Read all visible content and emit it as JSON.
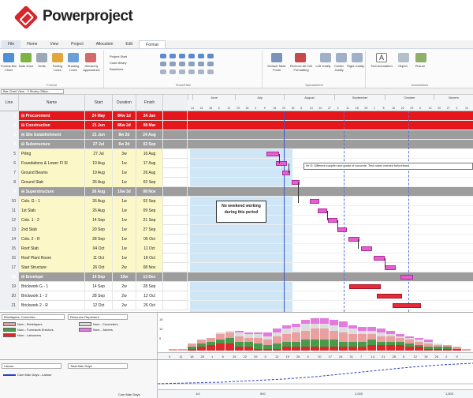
{
  "app": {
    "brand": "Powerproject"
  },
  "menu": {
    "tabs": [
      "File",
      "Home",
      "View",
      "Project",
      "Allocation",
      "Edit",
      "Format"
    ],
    "active": "Format"
  },
  "ribbon": {
    "groups": [
      {
        "name": "Format",
        "buttons": [
          "Format Bar Chart",
          "Date Zone",
          "Grids",
          "Rolling Lines",
          "Shading Lines",
          "Hierarchy Appearance"
        ]
      },
      {
        "name": "Show/Hide",
        "items": [
          "Project Start",
          "Code library",
          "Baselines"
        ]
      },
      {
        "name": "Spreadsheet",
        "buttons": [
          "Default Table Fonts",
          "Remove All Cell Formatting",
          "Left Justify",
          "Center Justify",
          "Right Justify"
        ]
      },
      {
        "name": "Annotations",
        "buttons": [
          "Text Annotation",
          "Object",
          "Picture"
        ]
      }
    ]
  },
  "view_selector": "Bar Chart View - 3 Storey Office...",
  "grid": {
    "headers": [
      "Line",
      "Name",
      "Start",
      "Duration",
      "Finish"
    ],
    "rows": [
      {
        "line": "1",
        "name": "⊟ Procurement",
        "start": "24 May",
        "duration": "84w 1d",
        "finish": "24 Jan",
        "style": "red"
      },
      {
        "line": "2",
        "name": "⊟ Construction",
        "start": "21 Jun",
        "duration": "86w 2d",
        "finish": "08 Mar",
        "style": "red"
      },
      {
        "line": "3",
        "name": "⊟ Site Establishment",
        "start": "21 Jun",
        "duration": "8w 2d",
        "finish": "24 Aug",
        "style": "grey"
      },
      {
        "line": "4",
        "name": "⊟ Substructure",
        "start": "27 Jul",
        "duration": "6w 2d",
        "finish": "02 Sep",
        "style": "grey"
      },
      {
        "line": "5",
        "name": "Piling",
        "start": "27 Jul",
        "duration": "3w",
        "finish": "16 Aug",
        "style": "yellow"
      },
      {
        "line": "6",
        "name": "Foundations & Lower Fl Sl",
        "start": "10 Aug",
        "duration": "1w",
        "finish": "17 Aug",
        "style": "yellow"
      },
      {
        "line": "7",
        "name": "Ground Beams",
        "start": "19 Aug",
        "duration": "1w",
        "finish": "26 Aug",
        "style": "yellow"
      },
      {
        "line": "8",
        "name": "Ground Slab",
        "start": "26 Aug",
        "duration": "1w",
        "finish": "02 Sep",
        "style": "yellow"
      },
      {
        "line": "9",
        "name": "⊟ Superstructure",
        "start": "26 Aug",
        "duration": "10w 3d",
        "finish": "08 Nov",
        "style": "grey"
      },
      {
        "line": "10",
        "name": "Cols. G - 1",
        "start": "26 Aug",
        "duration": "1w",
        "finish": "02 Sep",
        "style": "yellow"
      },
      {
        "line": "11",
        "name": "1st Slab",
        "start": "26 Aug",
        "duration": "1w",
        "finish": "09 Sep",
        "style": "yellow"
      },
      {
        "line": "12",
        "name": "Cols. 1 - 2",
        "start": "14 Sep",
        "duration": "1w",
        "finish": "21 Sep",
        "style": "yellow"
      },
      {
        "line": "13",
        "name": "2nd Slab",
        "start": "20 Sep",
        "duration": "1w",
        "finish": "27 Sep",
        "style": "yellow"
      },
      {
        "line": "14",
        "name": "Cols. 2 - R",
        "start": "28 Sep",
        "duration": "1w",
        "finish": "05 Oct",
        "style": "yellow"
      },
      {
        "line": "15",
        "name": "Roof Slab",
        "start": "04 Oct",
        "duration": "1w",
        "finish": "11 Oct",
        "style": "yellow"
      },
      {
        "line": "16",
        "name": "Roof Plant Room",
        "start": "11 Oct",
        "duration": "1w",
        "finish": "18 Oct",
        "style": "yellow"
      },
      {
        "line": "17",
        "name": "Stair Structure",
        "start": "26 Oct",
        "duration": "2w",
        "finish": "08 Nov",
        "style": "yellow"
      },
      {
        "line": "18",
        "name": "⊟ Envelope",
        "start": "14 Sep",
        "duration": "13w",
        "finish": "13 Dec",
        "style": "grey"
      },
      {
        "line": "19",
        "name": "Brickwork G - 1",
        "start": "14 Sep",
        "duration": "2w",
        "finish": "28 Sep",
        "style": "plain"
      },
      {
        "line": "20",
        "name": "Brickwork 1 - 2",
        "start": "28 Sep",
        "duration": "2w",
        "finish": "12 Oct",
        "style": "plain"
      },
      {
        "line": "21",
        "name": "Brickwork 2 - R",
        "start": "12 Oct",
        "duration": "2w",
        "finish": "26 Oct",
        "style": "plain"
      }
    ]
  },
  "timescale": {
    "months": [
      "June",
      "July",
      "August",
      "September",
      "October",
      "Novem"
    ],
    "days": [
      "14",
      "21",
      "28",
      "5",
      "12",
      "19",
      "26",
      "2",
      "9",
      "16",
      "23",
      "30",
      "6",
      "13",
      "20",
      "27",
      "4",
      "11",
      "18",
      "25",
      "1",
      "8",
      "15",
      "22",
      "29",
      "6",
      "13",
      "20",
      "27",
      "3",
      "10"
    ]
  },
  "annotations": {
    "note": "No weekend working during this period",
    "callout": "Mr D: Different supplier and grade of concrete. Test cubes needed beforehand."
  },
  "histogram": {
    "selector_left": "Bricklayers, Concreter...",
    "selector_right": "Resource Represent",
    "legend": [
      {
        "label": "Num - Bricklayers",
        "color": "#e9a0a0"
      },
      {
        "label": "Num - Concreters",
        "color": "#dddddd"
      },
      {
        "label": "Num - Formwork Erectors",
        "color": "#4a9a4a"
      },
      {
        "label": "Num - Joiners",
        "color": "#e27ae0"
      },
      {
        "label": "Num - Labourers",
        "color": "#d9292b"
      }
    ],
    "y_ticks": [
      "15",
      "10",
      "5"
    ],
    "scale": [
      "4",
      "11",
      "18",
      "25",
      "1",
      "8",
      "15",
      "22",
      "29",
      "5",
      "12",
      "19",
      "26",
      "3",
      "10",
      "17",
      "24",
      "31",
      "7",
      "14",
      "21",
      "28",
      "5",
      "12",
      "19",
      "26",
      "2",
      "9"
    ],
    "stack_data": [
      [
        1,
        0,
        0,
        0,
        0
      ],
      [
        1,
        0,
        0,
        0,
        0
      ],
      [
        2,
        0,
        1,
        0,
        1
      ],
      [
        2,
        0,
        2,
        0,
        2
      ],
      [
        2,
        0,
        2,
        0,
        3
      ],
      [
        3,
        1,
        2,
        0,
        4
      ],
      [
        3,
        1,
        3,
        0,
        4
      ],
      [
        3,
        2,
        3,
        1,
        2
      ],
      [
        2,
        2,
        3,
        1,
        2
      ],
      [
        3,
        2,
        3,
        1,
        1
      ],
      [
        3,
        2,
        2,
        2,
        1
      ],
      [
        4,
        2,
        3,
        2,
        1
      ],
      [
        4,
        3,
        3,
        2,
        2
      ],
      [
        5,
        3,
        3,
        2,
        2
      ],
      [
        5,
        4,
        4,
        2,
        2
      ],
      [
        6,
        3,
        4,
        3,
        2
      ],
      [
        6,
        3,
        4,
        3,
        2
      ],
      [
        5,
        3,
        4,
        3,
        2
      ],
      [
        5,
        3,
        3,
        3,
        2
      ],
      [
        4,
        3,
        3,
        2,
        2
      ],
      [
        4,
        2,
        3,
        2,
        2
      ],
      [
        3,
        2,
        3,
        2,
        3
      ],
      [
        3,
        2,
        2,
        2,
        3
      ],
      [
        3,
        1,
        2,
        2,
        3
      ],
      [
        2,
        1,
        2,
        1,
        3
      ],
      [
        2,
        1,
        2,
        1,
        2
      ],
      [
        2,
        1,
        1,
        1,
        2
      ],
      [
        2,
        1,
        1,
        1,
        1
      ],
      [
        1,
        1,
        1,
        0,
        1
      ],
      [
        1,
        0,
        1,
        0,
        1
      ],
      [
        1,
        0,
        0,
        0,
        1
      ],
      [
        1,
        0,
        0,
        0,
        0
      ]
    ]
  },
  "bottom": {
    "selector_left": "Labour",
    "selector_right": "Total Man Days",
    "legend": [
      "Cum Man Days - Labour"
    ],
    "row_label": "Cum Man Days",
    "scale": [
      "1/4",
      "500",
      "1,000",
      "1,500"
    ]
  }
}
